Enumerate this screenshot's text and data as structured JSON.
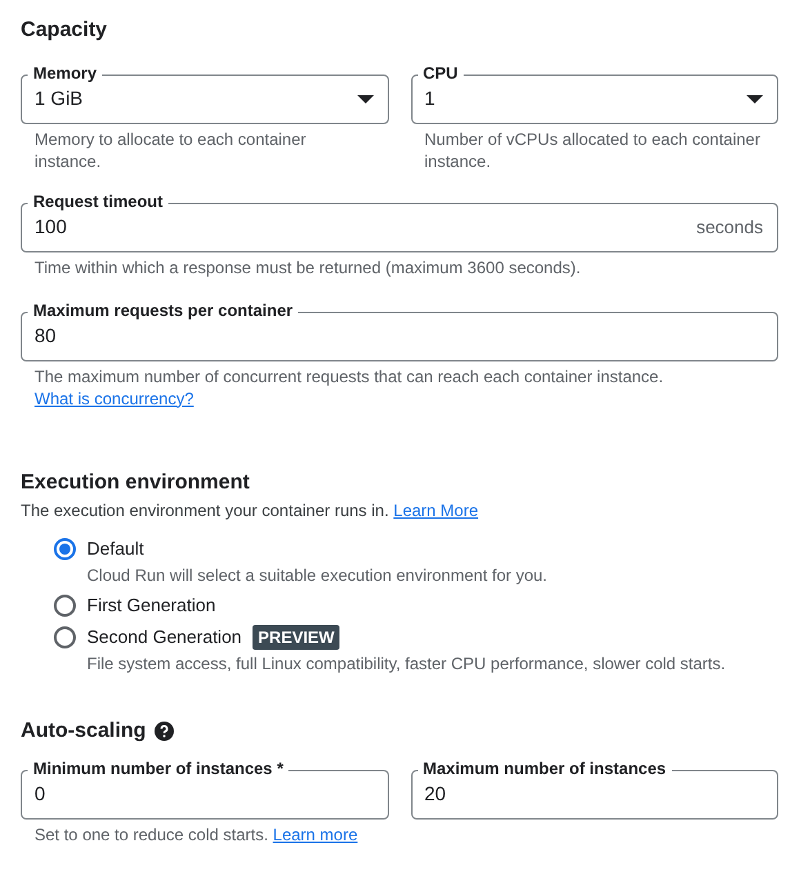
{
  "capacity": {
    "title": "Capacity",
    "field_pairs": [
      {
        "kind": "select",
        "label": "Memory",
        "value": "1 GiB",
        "helper": "Memory to allocate to each container instance."
      },
      {
        "kind": "select",
        "label": "CPU",
        "value": "1",
        "helper": "Number of vCPUs allocated to each container instance."
      }
    ],
    "fields": [
      {
        "label": "Request timeout",
        "value": "100",
        "suffix": "seconds",
        "helper": "Time within which a response must be returned (maximum 3600 seconds)."
      },
      {
        "label": "Maximum requests per container",
        "value": "80",
        "helper": "The maximum number of concurrent requests that can reach each container instance.",
        "helper_link": "What is concurrency?"
      }
    ]
  },
  "execution_environment": {
    "title": "Execution environment",
    "description": "The execution environment your container runs in.",
    "link": "Learn More",
    "options": [
      {
        "label": "Default",
        "selected": true,
        "description": "Cloud Run will select a suitable execution environment for you."
      },
      {
        "label": "First Generation",
        "selected": false
      },
      {
        "label": "Second Generation",
        "selected": false,
        "badge": "PREVIEW",
        "description": "File system access, full Linux compatibility, faster CPU performance, slower cold starts."
      }
    ]
  },
  "auto_scaling": {
    "title": "Auto-scaling",
    "fields": [
      {
        "label": "Minimum number of instances *",
        "value": "0"
      },
      {
        "label": "Maximum number of instances",
        "value": "20"
      }
    ],
    "helper": "Set to one to reduce cold starts.",
    "helper_link": "Learn more"
  }
}
